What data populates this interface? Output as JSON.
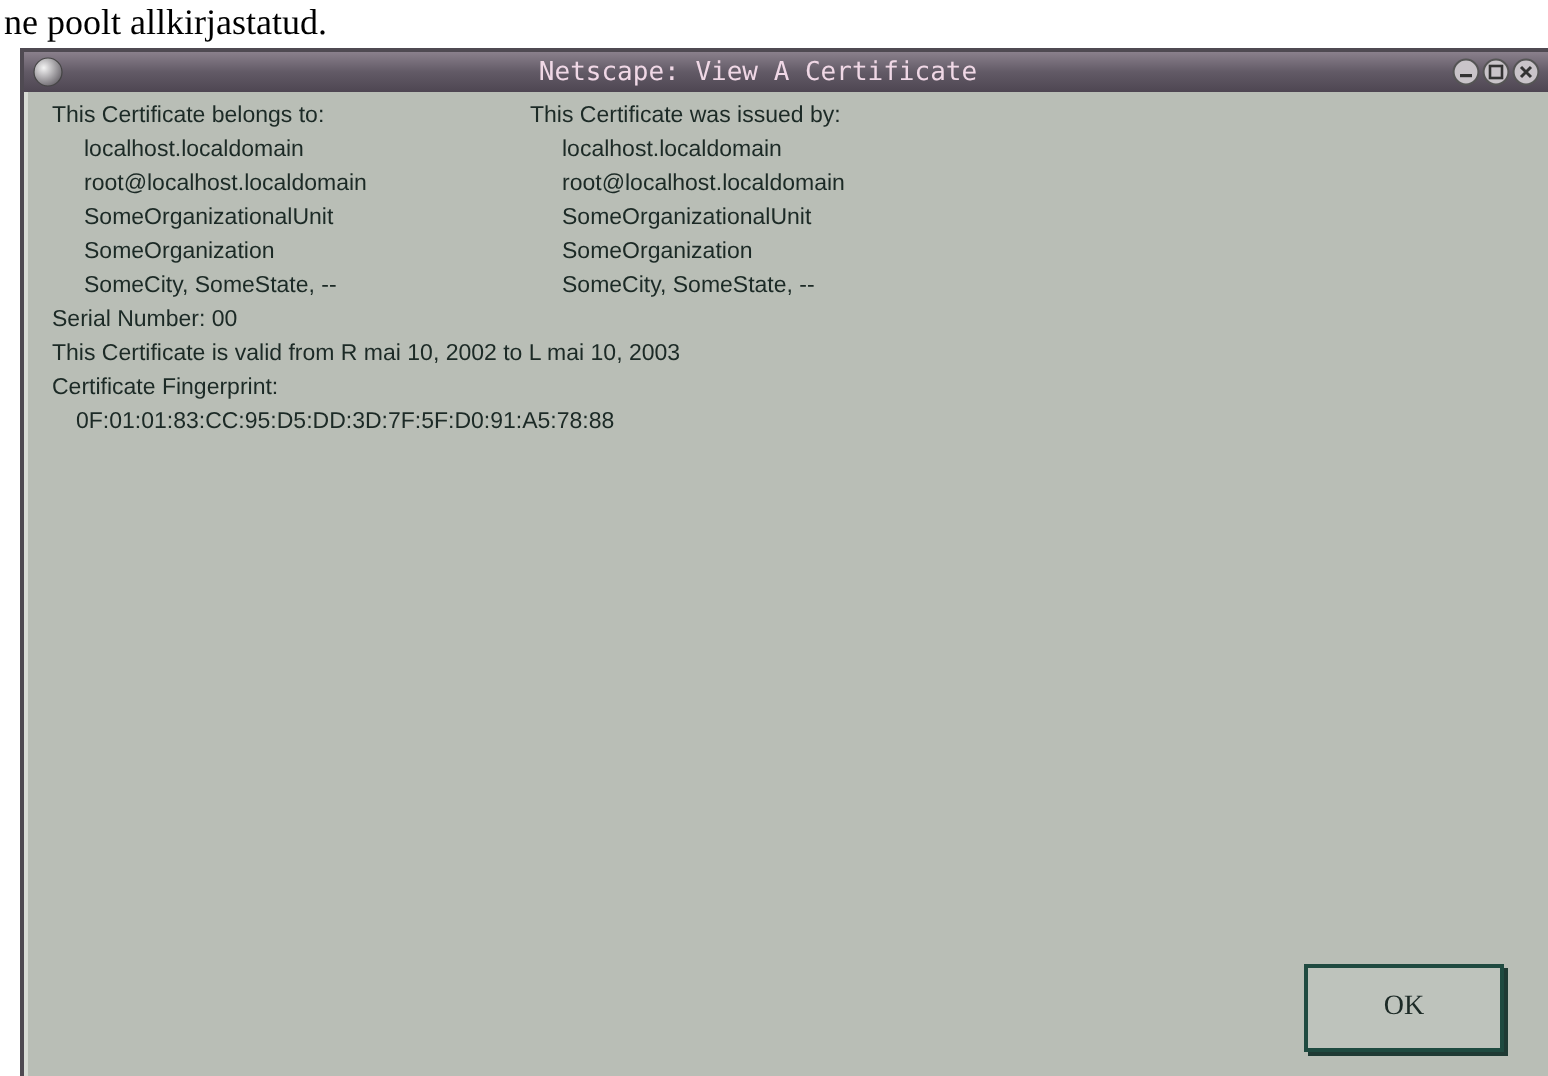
{
  "page_caption": "ne poolt allkirjastatud.",
  "window": {
    "title": "Netscape: View A Certificate"
  },
  "belongs_to": {
    "heading": "This Certificate belongs to:",
    "lines": [
      "localhost.localdomain",
      "root@localhost.localdomain",
      "SomeOrganizationalUnit",
      "SomeOrganization",
      "SomeCity, SomeState, --"
    ]
  },
  "issued_by": {
    "heading": "This Certificate was issued by:",
    "lines": [
      "localhost.localdomain",
      "root@localhost.localdomain",
      "SomeOrganizationalUnit",
      "SomeOrganization",
      "SomeCity, SomeState, --"
    ]
  },
  "serial": "Serial Number: 00",
  "validity": "This Certificate is valid from R mai 10, 2002 to L mai 10, 2003",
  "fingerprint_label": "Certificate Fingerprint:",
  "fingerprint": "0F:01:01:83:CC:95:D5:DD:3D:7F:5F:D0:91:A5:78:88",
  "buttons": [
    "OK"
  ]
}
